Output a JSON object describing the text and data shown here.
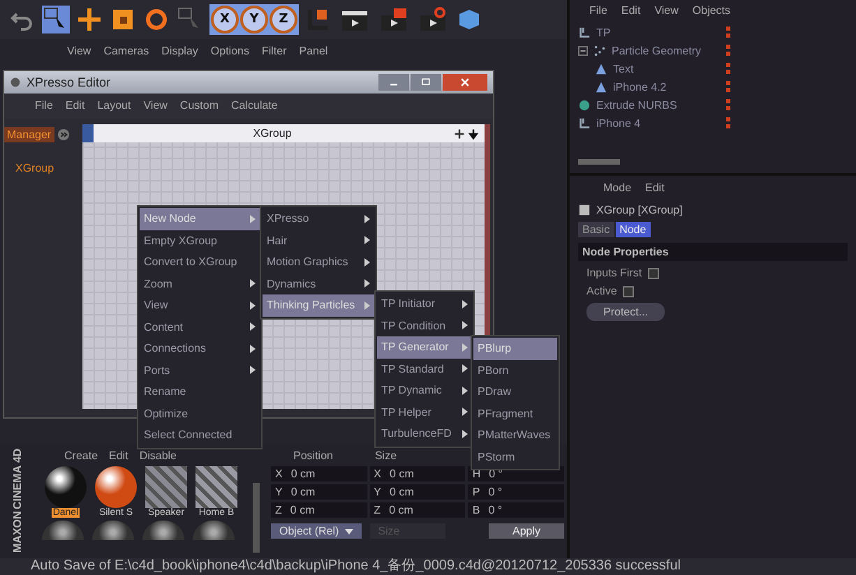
{
  "toolbar": {
    "axis_buttons": [
      {
        "label": "X",
        "selected": true
      },
      {
        "label": "Y",
        "selected": true
      },
      {
        "label": "Z",
        "selected": true
      }
    ]
  },
  "viewport": {
    "menu": [
      "View",
      "Cameras",
      "Display",
      "Options",
      "Filter",
      "Panel"
    ]
  },
  "xpresso_editor": {
    "title": "XPresso Editor",
    "menu": [
      "File",
      "Edit",
      "Layout",
      "View",
      "Custom",
      "Calculate"
    ],
    "manager_tab": "Manager",
    "tree_item": "XGroup",
    "graph_title": "XGroup"
  },
  "context_menus": [
    {
      "items": [
        {
          "label": "New Node",
          "submenu": true,
          "selected": true
        },
        {
          "label": "Empty XGroup",
          "submenu": false,
          "selected": false
        },
        {
          "label": "Convert to XGroup",
          "submenu": false,
          "selected": false
        },
        {
          "label": "Zoom",
          "submenu": true,
          "selected": false
        },
        {
          "label": "View",
          "submenu": true,
          "selected": false
        },
        {
          "label": "Content",
          "submenu": true,
          "selected": false
        },
        {
          "label": "Connections",
          "submenu": true,
          "selected": false
        },
        {
          "label": "Ports",
          "submenu": true,
          "selected": false
        },
        {
          "label": "Rename",
          "submenu": false,
          "selected": false
        },
        {
          "label": "Optimize",
          "submenu": false,
          "selected": false
        },
        {
          "label": "Select Connected",
          "submenu": false,
          "selected": false
        }
      ]
    },
    {
      "items": [
        {
          "label": "XPresso",
          "submenu": true,
          "selected": false
        },
        {
          "label": "Hair",
          "submenu": true,
          "selected": false
        },
        {
          "label": "Motion Graphics",
          "submenu": true,
          "selected": false
        },
        {
          "label": "Dynamics",
          "submenu": true,
          "selected": false
        },
        {
          "label": "Thinking Particles",
          "submenu": true,
          "selected": true
        }
      ]
    },
    {
      "items": [
        {
          "label": "TP Initiator",
          "submenu": true,
          "selected": false
        },
        {
          "label": "TP Condition",
          "submenu": true,
          "selected": false
        },
        {
          "label": "TP Generator",
          "submenu": true,
          "selected": true
        },
        {
          "label": "TP Standard",
          "submenu": true,
          "selected": false
        },
        {
          "label": "TP Dynamic",
          "submenu": true,
          "selected": false
        },
        {
          "label": "TP Helper",
          "submenu": true,
          "selected": false
        },
        {
          "label": "TurbulenceFD",
          "submenu": true,
          "selected": false
        }
      ]
    },
    {
      "items": [
        {
          "label": "PBlurp",
          "submenu": false,
          "selected": true
        },
        {
          "label": "PBorn",
          "submenu": false,
          "selected": false
        },
        {
          "label": "PDraw",
          "submenu": false,
          "selected": false
        },
        {
          "label": "PFragment",
          "submenu": false,
          "selected": false
        },
        {
          "label": "PMatterWaves",
          "submenu": false,
          "selected": false
        },
        {
          "label": "PStorm",
          "submenu": false,
          "selected": false
        }
      ]
    }
  ],
  "logo": {
    "line_1": "MAXON",
    "line_2": "CINEMA 4D"
  },
  "materials": {
    "menu": [
      "Create",
      "Edit",
      "Disable"
    ],
    "items": [
      {
        "name": "Danel",
        "kind": "sphere",
        "color": "#111111",
        "selected": true
      },
      {
        "name": "Silent S",
        "kind": "sphere",
        "color": "#d04a14",
        "selected": false
      },
      {
        "name": "Speaker",
        "kind": "texture",
        "color": "#8a8a94",
        "selected": false
      },
      {
        "name": "Home B",
        "kind": "texture",
        "color": "#9a9aa4",
        "selected": false
      }
    ]
  },
  "coordinates": {
    "headers": [
      "Position",
      "Size"
    ],
    "rows": [
      {
        "axis": "X",
        "position": "0 cm",
        "size_axis": "X",
        "size": "0 cm",
        "rotation_axis": "H",
        "rotation": "0 °"
      },
      {
        "axis": "Y",
        "position": "0 cm",
        "size_axis": "Y",
        "size": "0 cm",
        "rotation_axis": "P",
        "rotation": "0 °"
      },
      {
        "axis": "Z",
        "position": "0 cm",
        "size_axis": "Z",
        "size": "0 cm",
        "rotation_axis": "B",
        "rotation": "0 °"
      }
    ],
    "mode": "Object (Rel)",
    "size_mode": {
      "label": "Size",
      "disabled": true
    },
    "apply": "Apply"
  },
  "object_manager": {
    "menu": [
      "File",
      "Edit",
      "View",
      "Objects"
    ],
    "tree": [
      {
        "name": "TP",
        "kind": "null"
      },
      {
        "name": "Particle Geometry",
        "kind": "particles",
        "expanded": true,
        "children": [
          {
            "name": "Text",
            "kind": "cone"
          },
          {
            "name": "iPhone 4.2",
            "kind": "cone"
          }
        ]
      },
      {
        "name": "Extrude NURBS",
        "kind": "nurbs"
      },
      {
        "name": "iPhone 4",
        "kind": "null"
      }
    ]
  },
  "attribute_manager": {
    "menu": [
      "Mode",
      "Edit"
    ],
    "object": "XGroup [XGroup]",
    "tabs": [
      {
        "label": "Basic",
        "selected": false
      },
      {
        "label": "Node",
        "selected": true
      }
    ],
    "section": "Node Properties",
    "fields": [
      {
        "label": "Inputs First",
        "checked": false
      },
      {
        "label": "Active",
        "checked": false
      }
    ],
    "button": "Protect..."
  },
  "status_bar": "Auto Save of E:\\c4d_book\\iphone4\\c4d\\backup\\iPhone 4_备份_0009.c4d@20120712_205336 successful"
}
